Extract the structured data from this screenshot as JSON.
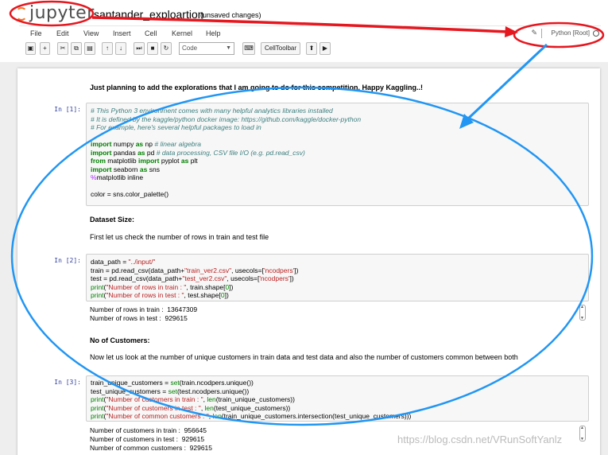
{
  "header": {
    "logo_text": "jupyter",
    "notebook_name": "santander_exploartion",
    "save_status": "(unsaved changes)"
  },
  "menubar": {
    "items": [
      "File",
      "Edit",
      "View",
      "Insert",
      "Cell",
      "Kernel",
      "Help"
    ],
    "kernel_name": "Python [Root]"
  },
  "toolbar": {
    "cell_type": "Code",
    "celltoolbar_label": "CellToolbar"
  },
  "cells": {
    "md1": "Just planning to add the explorations that I am going to do for this competition. Happy Kaggling..!",
    "in1_prompt": "In [1]:",
    "in1_lines": [
      "# This Python 3 environment comes with many helpful analytics libraries installed",
      "# It is defined by the kaggle/python docker image: https://github.com/kaggle/docker-python",
      "# For example, here's several helpful packages to load in",
      "",
      "import numpy as np # linear algebra",
      "import pandas as pd # data processing, CSV file I/O (e.g. pd.read_csv)",
      "from matplotlib import pyplot as plt",
      "import seaborn as sns",
      "%matplotlib inline",
      "",
      "color = sns.color_palette()"
    ],
    "md2_heading": "Dataset Size:",
    "md2_text": "First let us check the number of rows in train and test file",
    "in2_prompt": "In [2]:",
    "in2_lines": [
      "data_path = \"../input/\"",
      "train = pd.read_csv(data_path+\"train_ver2.csv\", usecols=['ncodpers'])",
      "test = pd.read_csv(data_path+\"test_ver2.csv\", usecols=['ncodpers'])",
      "print(\"Number of rows in train : \", train.shape[0])",
      "print(\"Number of rows in test : \", test.shape[0])"
    ],
    "out2_lines": [
      "Number of rows in train :  13647309",
      "Number of rows in test :  929615"
    ],
    "md3_heading": "No of Customers:",
    "md3_text": "Now let us look at the number of unique customers in train data and test data and also the number of customers common between both",
    "in3_prompt": "In [3]:",
    "in3_lines": [
      "train_unique_customers = set(train.ncodpers.unique())",
      "test_unique_customers = set(test.ncodpers.unique())",
      "print(\"Number of customers in train : \", len(train_unique_customers))",
      "print(\"Number of customers in test : \", len(test_unique_customers))",
      "print(\"Number of common customers : \", len(train_unique_customers.intersection(test_unique_customers)))"
    ],
    "out3_lines": [
      "Number of customers in train :  956645",
      "Number of customers in test :  929615",
      "Number of common customers :  929615"
    ]
  },
  "watermark": "https://blog.csdn.net/VRunSoftYanlz",
  "colors": {
    "annotation_red": "#e5171f",
    "annotation_blue": "#2196f3",
    "jupyter_orange": "#f37726"
  }
}
